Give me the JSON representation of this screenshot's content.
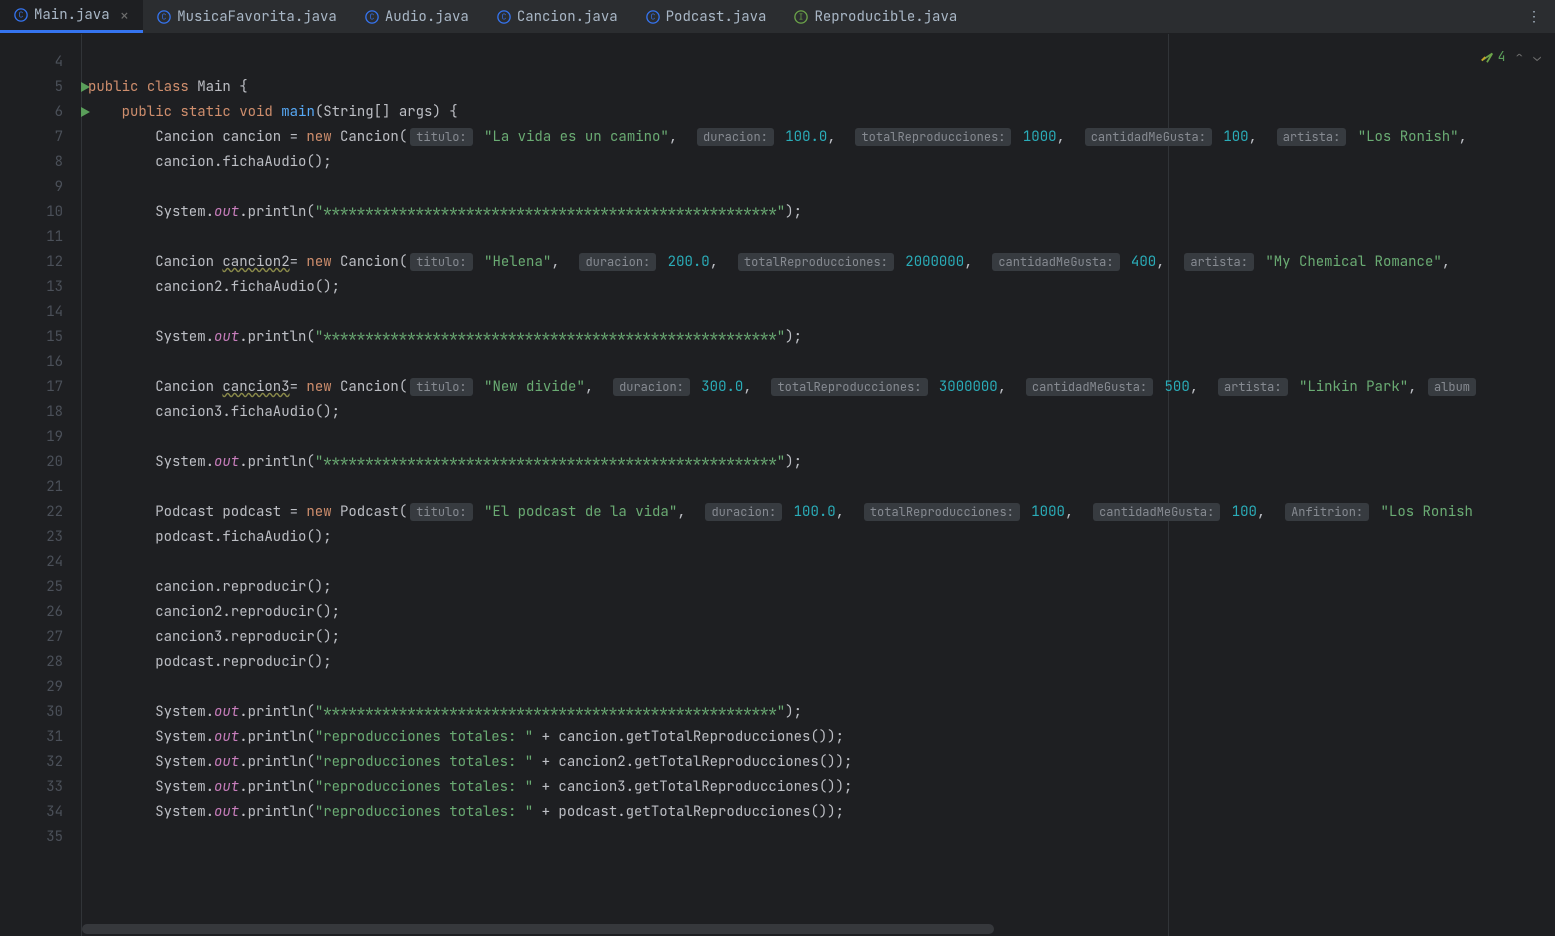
{
  "tabs": [
    {
      "name": "Main.java",
      "active": true,
      "iconColor": "#3574f0"
    },
    {
      "name": "MusicaFavorita.java",
      "active": false,
      "iconColor": "#3574f0"
    },
    {
      "name": "Audio.java",
      "active": false,
      "iconColor": "#3574f0"
    },
    {
      "name": "Cancion.java",
      "active": false,
      "iconColor": "#3574f0"
    },
    {
      "name": "Podcast.java",
      "active": false,
      "iconColor": "#3574f0"
    },
    {
      "name": "Reproducible.java",
      "active": false,
      "iconColor": "#6ba349"
    }
  ],
  "status": {
    "warnings": "4"
  },
  "lineStart": 4,
  "lineEnd": 35,
  "runMarkers": [
    5,
    6
  ],
  "code": {
    "l5": {
      "kw1": "public",
      "kw2": "class",
      "name": "Main",
      "brace": "{"
    },
    "l6": {
      "kw1": "public",
      "kw2": "static",
      "kw3": "void",
      "fn": "main",
      "args": "(String[] args) {"
    },
    "l7": {
      "t": "Cancion cancion = ",
      "kw": "new",
      "ctor": " Cancion(",
      "h1": "titulo:",
      "s1": "\"La vida es un camino\"",
      "c1": ", ",
      "h2": "duracion:",
      "n1": "100.0",
      "c2": ", ",
      "h3": "totalReproducciones:",
      "n2": "1000",
      "c3": ", ",
      "h4": "cantidadMeGusta:",
      "n3": "100",
      "c4": ", ",
      "h5": "artista:",
      "s2": "\"Los Ronish\"",
      "end": ","
    },
    "l8": {
      "t": "cancion.fichaAudio();"
    },
    "l10": {
      "a": "System.",
      "b": "out",
      "c": ".println(",
      "s": "\"******************************************************\"",
      "e": ");"
    },
    "l12": {
      "t": "Cancion ",
      "v": "cancion2",
      "eq": "= ",
      "kw": "new",
      "ctor": " Cancion(",
      "h1": "titulo:",
      "s1": "\"Helena\"",
      "c1": ", ",
      "h2": "duracion:",
      "n1": "200.0",
      "c2": ", ",
      "h3": "totalReproducciones:",
      "n2": "2000000",
      "c3": ", ",
      "h4": "cantidadMeGusta:",
      "n3": "400",
      "c4": ", ",
      "h5": "artista:",
      "s2": "\"My Chemical Romance\"",
      "end": ","
    },
    "l13": {
      "t": "cancion2.fichaAudio();"
    },
    "l15": {
      "a": "System.",
      "b": "out",
      "c": ".println(",
      "s": "\"******************************************************\"",
      "e": ");"
    },
    "l17": {
      "t": "Cancion ",
      "v": "cancion3",
      "eq": "= ",
      "kw": "new",
      "ctor": " Cancion(",
      "h1": "titulo:",
      "s1": "\"New divide\"",
      "c1": ", ",
      "h2": "duracion:",
      "n1": "300.0",
      "c2": ", ",
      "h3": "totalReproducciones:",
      "n2": "3000000",
      "c3": ", ",
      "h4": "cantidadMeGusta:",
      "n3": "500",
      "c4": ", ",
      "h5": "artista:",
      "s2": "\"Linkin Park\"",
      "end": ", ",
      "h6": "album"
    },
    "l18": {
      "t": "cancion3.fichaAudio();"
    },
    "l20": {
      "a": "System.",
      "b": "out",
      "c": ".println(",
      "s": "\"******************************************************\"",
      "e": ");"
    },
    "l22": {
      "t": "Podcast podcast = ",
      "kw": "new",
      "ctor": " Podcast(",
      "h1": "titulo:",
      "s1": "\"El podcast de la vida\"",
      "c1": ", ",
      "h2": "duracion:",
      "n1": "100.0",
      "c2": ", ",
      "h3": "totalReproducciones:",
      "n2": "1000",
      "c3": ", ",
      "h4": "cantidadMeGusta:",
      "n3": "100",
      "c4": ", ",
      "h5": "Anfitrion:",
      "s2": "\"Los Ronish"
    },
    "l23": {
      "t": "podcast.fichaAudio();"
    },
    "l25": {
      "t": "cancion.reproducir();"
    },
    "l26": {
      "t": "cancion2.reproducir();"
    },
    "l27": {
      "t": "cancion3.reproducir();"
    },
    "l28": {
      "t": "podcast.reproducir();"
    },
    "l30": {
      "a": "System.",
      "b": "out",
      "c": ".println(",
      "s": "\"******************************************************\"",
      "e": ");"
    },
    "l31": {
      "a": "System.",
      "b": "out",
      "c": ".println(",
      "s": "\"reproducciones totales: \"",
      "m": " + cancion.getTotalReproducciones());"
    },
    "l32": {
      "a": "System.",
      "b": "out",
      "c": ".println(",
      "s": "\"reproducciones totales: \"",
      "m": " + cancion2.getTotalReproducciones());"
    },
    "l33": {
      "a": "System.",
      "b": "out",
      "c": ".println(",
      "s": "\"reproducciones totales: \"",
      "m": " + cancion3.getTotalReproducciones());"
    },
    "l34": {
      "a": "System.",
      "b": "out",
      "c": ".println(",
      "s": "\"reproducciones totales: \"",
      "m": " + podcast.getTotalReproducciones());"
    }
  }
}
